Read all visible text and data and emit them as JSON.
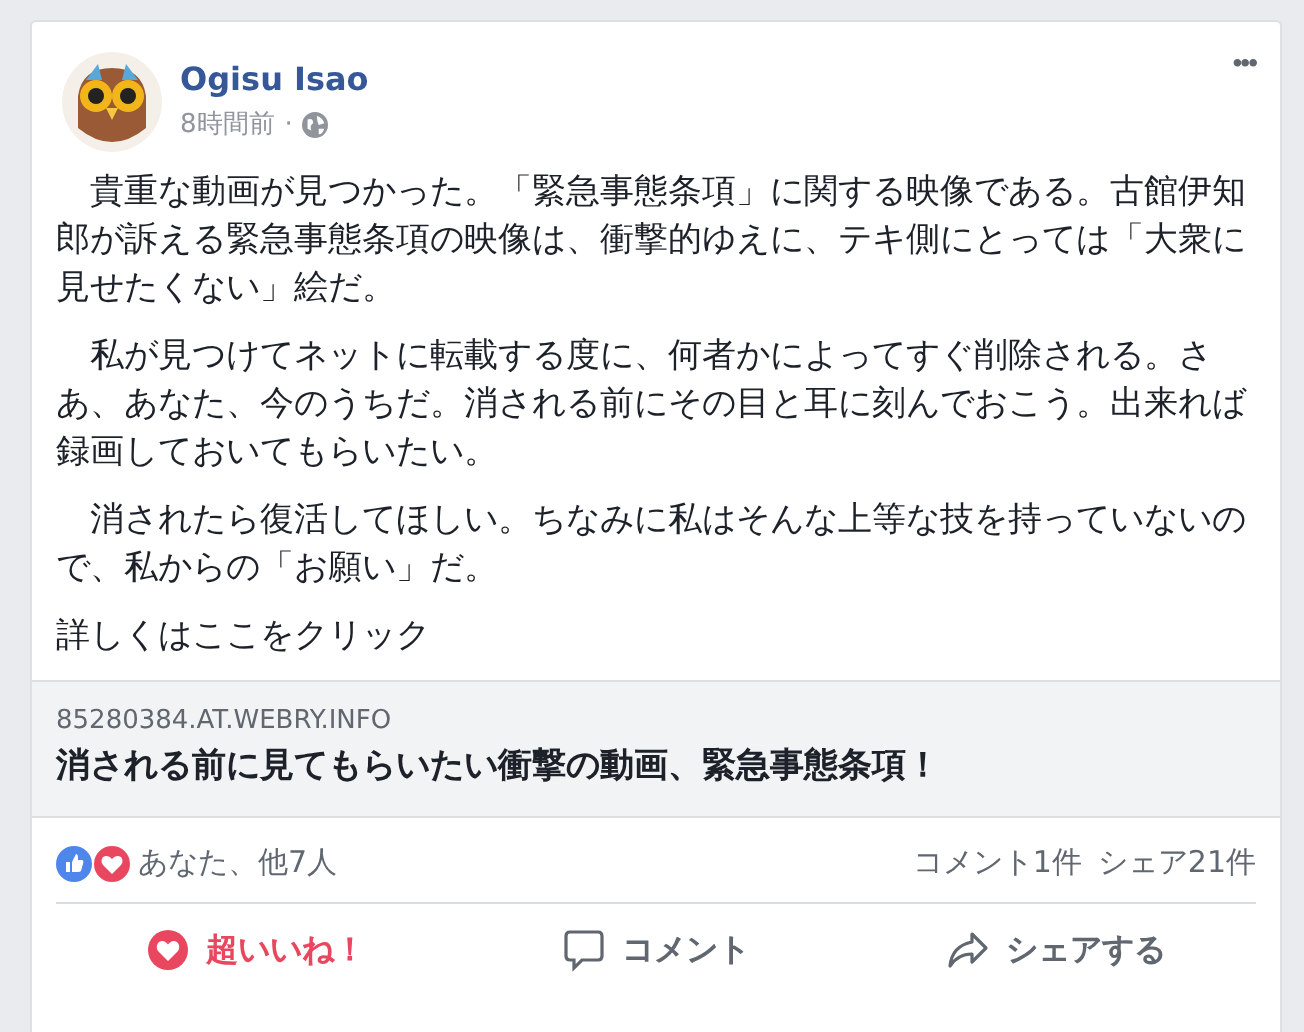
{
  "post": {
    "author": "Ogisu Isao",
    "time": "8時間前",
    "separator": "·",
    "menu": "•••",
    "paragraphs": [
      "　貴重な動画が見つかった。「緊急事態条項」に関する映像である。古館伊知郎が訴える緊急事態条項の映像は、衝撃的ゆえに、テキ側にとっては「大衆に見せたくない」絵だ。",
      "　私が見つけてネットに転載する度に、何者かによってすぐ削除される。さあ、あなた、今のうちだ。消される前にその目と耳に刻んでおこう。出来れば録画しておいてもらいたい。",
      "　消されたら復活してほしい。ちなみに私はそんな上等な技を持っていないので、私からの「お願い」だ。",
      "詳しくはここをクリック"
    ]
  },
  "link_preview": {
    "domain": "85280384.AT.WEBRY.INFO",
    "title": "消される前に見てもらいたい衝撃の動画、緊急事態条項！"
  },
  "reactions": {
    "summary": "あなた、他7人",
    "comments": "コメント1件",
    "shares": "シェア21件"
  },
  "actions": [
    {
      "kind": "love",
      "label": "超いいね！",
      "selected": true
    },
    {
      "kind": "comment",
      "label": "コメント",
      "selected": false
    },
    {
      "kind": "share",
      "label": "シェアする",
      "selected": false
    }
  ]
}
